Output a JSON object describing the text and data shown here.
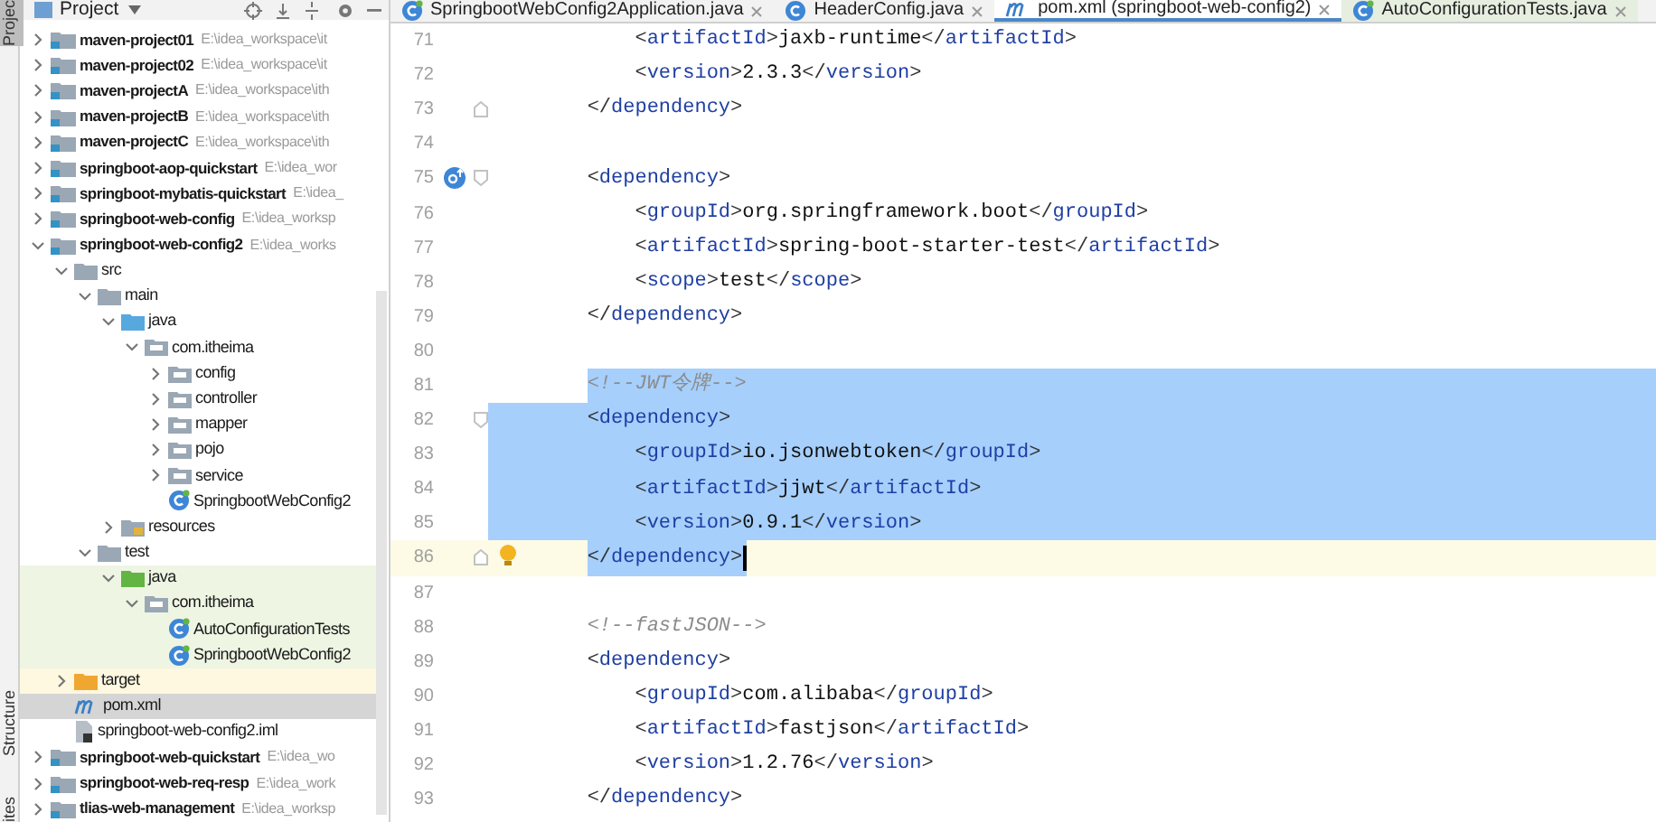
{
  "tool_strip": {
    "tabs": [
      {
        "label": "Projec",
        "selected": true
      },
      {
        "label": "Structure",
        "selected": false
      },
      {
        "label": "ites",
        "selected": false
      }
    ]
  },
  "project_panel": {
    "title": "Project",
    "tree": [
      {
        "kind": "module",
        "label": "maven-project01",
        "path": "E:\\idea_workspace\\it",
        "expanded": false,
        "selected": false
      },
      {
        "kind": "module",
        "label": "maven-project02",
        "path": "E:\\idea_workspace\\it",
        "expanded": false,
        "selected": false
      },
      {
        "kind": "module",
        "label": "maven-projectA",
        "path": "E:\\idea_workspace\\ith",
        "expanded": false,
        "selected": false
      },
      {
        "kind": "module",
        "label": "maven-projectB",
        "path": "E:\\idea_workspace\\ith",
        "expanded": false,
        "selected": false
      },
      {
        "kind": "module",
        "label": "maven-projectC",
        "path": "E:\\idea_workspace\\ith",
        "expanded": false,
        "selected": false
      },
      {
        "kind": "module",
        "label": "springboot-aop-quickstart",
        "path": "E:\\idea_wor",
        "expanded": false,
        "selected": false
      },
      {
        "kind": "module",
        "label": "springboot-mybatis-quickstart",
        "path": "E:\\idea_",
        "expanded": false,
        "selected": false
      },
      {
        "kind": "module",
        "label": "springboot-web-config",
        "path": "E:\\idea_worksp",
        "expanded": false,
        "selected": false
      },
      {
        "kind": "module",
        "label": "springboot-web-config2",
        "path": "E:\\idea_works",
        "expanded": true,
        "selected": false,
        "children": [
          {
            "kind": "folder",
            "label": "src",
            "expanded": true,
            "selected": false,
            "children": [
              {
                "kind": "folder",
                "label": "main",
                "expanded": true,
                "selected": false,
                "children": [
                  {
                    "kind": "source",
                    "label": "java",
                    "expanded": true,
                    "selected": false,
                    "children": [
                      {
                        "kind": "package",
                        "label": "com.itheima",
                        "expanded": true,
                        "selected": false,
                        "children": [
                          {
                            "kind": "package",
                            "label": "config",
                            "expanded": false,
                            "selected": false
                          },
                          {
                            "kind": "package",
                            "label": "controller",
                            "expanded": false,
                            "selected": false
                          },
                          {
                            "kind": "package",
                            "label": "mapper",
                            "expanded": false,
                            "selected": false
                          },
                          {
                            "kind": "package",
                            "label": "pojo",
                            "expanded": false,
                            "selected": false
                          },
                          {
                            "kind": "package",
                            "label": "service",
                            "expanded": false,
                            "selected": false
                          },
                          {
                            "kind": "app-class",
                            "label": "SpringbootWebConfig2",
                            "selected": false
                          }
                        ]
                      }
                    ]
                  },
                  {
                    "kind": "resources",
                    "label": "resources",
                    "expanded": false,
                    "selected": false
                  }
                ]
              },
              {
                "kind": "folder",
                "label": "test",
                "expanded": true,
                "selected": false,
                "children": [
                  {
                    "kind": "test-source",
                    "label": "java",
                    "expanded": true,
                    "selected": false,
                    "children": [
                      {
                        "kind": "package",
                        "label": "com.itheima",
                        "expanded": true,
                        "selected": false,
                        "children": [
                          {
                            "kind": "test-class",
                            "label": "AutoConfigurationTests",
                            "selected": false
                          },
                          {
                            "kind": "test-class",
                            "label": "SpringbootWebConfig2",
                            "selected": false
                          }
                        ]
                      }
                    ]
                  }
                ]
              }
            ]
          },
          {
            "kind": "excluded",
            "label": "target",
            "expanded": false,
            "selected": false
          },
          {
            "kind": "maven",
            "label": "pom.xml",
            "selected": true
          },
          {
            "kind": "iml",
            "label": "springboot-web-config2.iml",
            "selected": false
          }
        ]
      },
      {
        "kind": "module",
        "label": "springboot-web-quickstart",
        "path": "E:\\idea_wo",
        "expanded": false,
        "selected": false
      },
      {
        "kind": "module",
        "label": "springboot-web-req-resp",
        "path": "E:\\idea_work",
        "expanded": false,
        "selected": false
      },
      {
        "kind": "module",
        "label": "tlias-web-management",
        "path": "E:\\idea_worksp",
        "expanded": false,
        "selected": false
      }
    ]
  },
  "editor_tabs": [
    {
      "kind": "app-class",
      "label": "SpringbootWebConfig2Application.java",
      "selected": false
    },
    {
      "kind": "class",
      "label": "HeaderConfig.java",
      "selected": false
    },
    {
      "kind": "maven",
      "label": "pom.xml (springboot-web-config2)",
      "selected": true
    },
    {
      "kind": "test-class",
      "label": "AutoConfigurationTests.java",
      "selected": false
    }
  ],
  "code_lines": [
    {
      "number": "71",
      "text": "            <artifactId>jaxb-runtime</artifactId>",
      "selected": false,
      "current": false
    },
    {
      "number": "72",
      "text": "            <version>2.3.3</version>",
      "selected": false,
      "current": false
    },
    {
      "number": "73",
      "text": "        </dependency>",
      "selected": false,
      "current": false,
      "fold_end": true
    },
    {
      "number": "74",
      "selected": false,
      "current": false
    },
    {
      "number": "75",
      "text": "        <dependency>",
      "selected": false,
      "current": false,
      "fold_start": true,
      "override_marker": true
    },
    {
      "number": "76",
      "text": "            <groupId>org.springframework.boot</groupId>",
      "selected": false,
      "current": false
    },
    {
      "number": "77",
      "text": "            <artifactId>spring-boot-starter-test</artifactId>",
      "selected": false,
      "current": false
    },
    {
      "number": "78",
      "text": "            <scope>test</scope>",
      "selected": false,
      "current": false
    },
    {
      "number": "79",
      "text": "        </dependency>",
      "selected": false,
      "current": false
    },
    {
      "number": "80",
      "selected": false,
      "current": false
    },
    {
      "number": "81",
      "text": "        <!--JWT令牌-->",
      "selected": true,
      "current": false
    },
    {
      "number": "82",
      "text": "        <dependency>",
      "selected": true,
      "current": false,
      "fold_start": true
    },
    {
      "number": "83",
      "text": "            <groupId>io.jsonwebtoken</groupId>",
      "selected": true,
      "current": false
    },
    {
      "number": "84",
      "text": "            <artifactId>jjwt</artifactId>",
      "selected": true,
      "current": false
    },
    {
      "number": "85",
      "text": "            <version>0.9.1</version>",
      "selected": true,
      "current": false
    },
    {
      "number": "86",
      "text": "        </dependency>",
      "selected": true,
      "current": true,
      "fold_end": true,
      "bulb": true
    },
    {
      "number": "87",
      "selected": false,
      "current": false
    },
    {
      "number": "88",
      "text": "        <!--fastJSON-->",
      "selected": false,
      "current": false
    },
    {
      "number": "89",
      "text": "        <dependency>",
      "selected": false,
      "current": false
    },
    {
      "number": "90",
      "text": "            <groupId>com.alibaba</groupId>",
      "selected": false,
      "current": false
    },
    {
      "number": "91",
      "text": "            <artifactId>fastjson</artifactId>",
      "selected": false,
      "current": false
    },
    {
      "number": "92",
      "text": "            <version>1.2.76</version>",
      "selected": false,
      "current": false
    },
    {
      "number": "93",
      "text": "        </dependency>",
      "selected": false,
      "current": false
    }
  ]
}
